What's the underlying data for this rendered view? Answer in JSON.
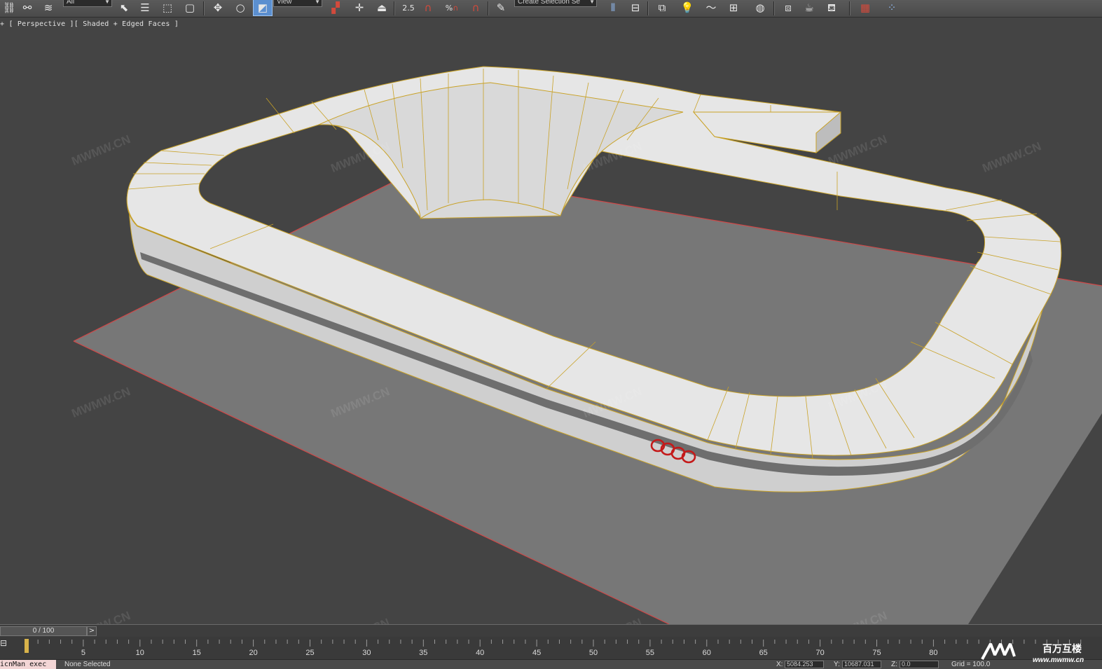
{
  "toolbar": {
    "selection_filter": "All",
    "reference_coord": "View",
    "named_selection_placeholder": "Create Selection Se",
    "angle_snap_label": "2.5",
    "percent_snap_label": "%"
  },
  "viewport": {
    "label": "+ [ Perspective ][ Shaded + Edged Faces ]",
    "watermark": "MWMW.CN"
  },
  "timeline": {
    "frame_counter": "0 / 100",
    "next_button": ">",
    "ticks": [
      "5",
      "10",
      "15",
      "20",
      "25",
      "30",
      "35",
      "40",
      "45",
      "50",
      "55",
      "60",
      "65",
      "70",
      "75",
      "80"
    ]
  },
  "status": {
    "maxscript": "icnMan exec",
    "selection": "None Selected",
    "x_label": "X:",
    "x_value": "5084.253",
    "y_label": "Y:",
    "y_value": "10687.031",
    "z_label": "Z:",
    "z_value": "0.0",
    "grid": "Grid = 100.0"
  },
  "brand": {
    "logo_text": "MW",
    "site": "www.mwmw.cn",
    "chinese": "百万互楼"
  },
  "colors": {
    "viewport_bg": "#444444",
    "model_white": "#e8e8e8",
    "edge_yellow": "#c9a227",
    "ground_grey": "#777777",
    "ring_red": "#c41a1a"
  }
}
